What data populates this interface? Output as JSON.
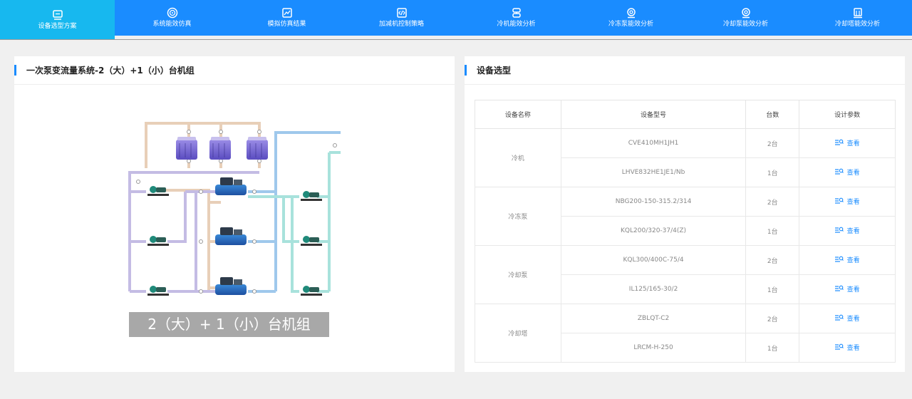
{
  "nav": {
    "tabs": [
      {
        "label": "设备选型方案",
        "icon": "monitor-icon",
        "active": true
      },
      {
        "label": "系统能效仿真",
        "icon": "spiral-icon",
        "active": false
      },
      {
        "label": "模拟仿真结果",
        "icon": "chart-icon",
        "active": false
      },
      {
        "label": "加减机控制策略",
        "icon": "code-icon",
        "active": false
      },
      {
        "label": "冷机能效分析",
        "icon": "chiller-icon",
        "active": false
      },
      {
        "label": "冷冻泵能效分析",
        "icon": "pump-icon",
        "active": false
      },
      {
        "label": "冷却泵能效分析",
        "icon": "pump-icon",
        "active": false
      },
      {
        "label": "冷却塔能效分析",
        "icon": "tower-icon",
        "active": false
      }
    ]
  },
  "left": {
    "title": "一次泵变流量系统-2（大）+1（小）台机组",
    "caption": "2（大）+ 1（小）台机组"
  },
  "right": {
    "title": "设备选型",
    "headers": [
      "设备名称",
      "设备型号",
      "台数",
      "设计参数"
    ],
    "view_label": "查看",
    "groups": [
      {
        "name": "冷机",
        "rows": [
          {
            "model": "CVE410MH1JH1",
            "qty": "2台"
          },
          {
            "model": "LHVE832HE1JE1/Nb",
            "qty": "1台"
          }
        ]
      },
      {
        "name": "冷冻泵",
        "rows": [
          {
            "model": "NBG200-150-315.2/314",
            "qty": "2台"
          },
          {
            "model": "KQL200/320-37/4(Z)",
            "qty": "1台"
          }
        ]
      },
      {
        "name": "冷却泵",
        "rows": [
          {
            "model": "KQL300/400C-75/4",
            "qty": "2台"
          },
          {
            "model": "IL125/165-30/2",
            "qty": "1台"
          }
        ]
      },
      {
        "name": "冷却塔",
        "rows": [
          {
            "model": "ZBLQT-C2",
            "qty": "2台"
          },
          {
            "model": "LRCM-H-250",
            "qty": "1台"
          }
        ]
      }
    ]
  },
  "colors": {
    "nav": "#1a8cff",
    "nav_active": "#17b8ef",
    "accent": "#1a8cff"
  }
}
